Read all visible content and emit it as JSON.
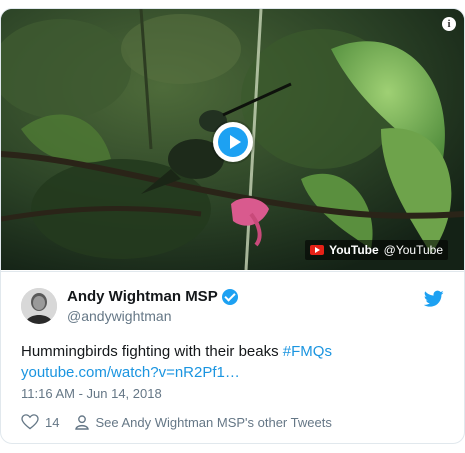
{
  "video": {
    "brand": "YouTube",
    "handle": "@YouTube",
    "icons": [
      "info-icon",
      "play-icon",
      "youtube-logo-icon"
    ]
  },
  "tweet": {
    "author_name": "Andy Wightman MSP",
    "author_handle": "@andywightman",
    "text_plain": "Hummingbirds fighting with their beaks ",
    "hashtag": "#FMQs",
    "link": "youtube.com/watch?v=nR2Pf1…",
    "timestamp": "11:16 AM - Jun 14, 2018",
    "like_count": "14",
    "other_tweets": "See Andy Wightman MSP's other Tweets"
  },
  "colors": {
    "accent": "#1da1f2",
    "link": "#1b95e0",
    "muted": "#657786",
    "youtube_red": "#e62117"
  }
}
